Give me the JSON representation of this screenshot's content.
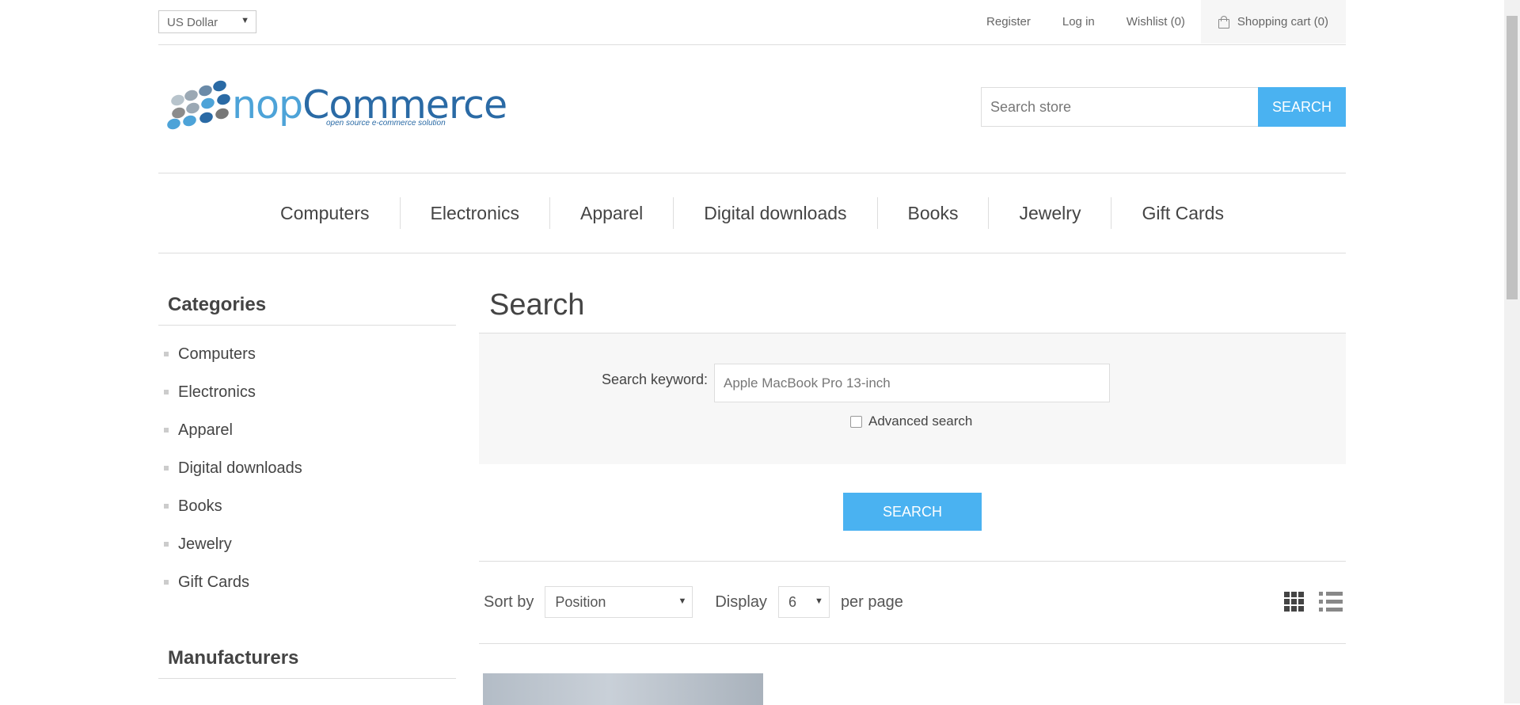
{
  "header": {
    "currency": "US Dollar",
    "links": {
      "register": "Register",
      "login": "Log in",
      "wishlist": "Wishlist (0)",
      "cart": "Shopping cart (0)"
    }
  },
  "logo": {
    "brand_part1": "nop",
    "brand_part2": "Commerce",
    "tagline": "open source e-commerce solution"
  },
  "store_search": {
    "placeholder": "Search store",
    "button": "SEARCH"
  },
  "top_menu": [
    "Computers",
    "Electronics",
    "Apparel",
    "Digital downloads",
    "Books",
    "Jewelry",
    "Gift Cards"
  ],
  "sidebar": {
    "categories_title": "Categories",
    "categories": [
      "Computers",
      "Electronics",
      "Apparel",
      "Digital downloads",
      "Books",
      "Jewelry",
      "Gift Cards"
    ],
    "manufacturers_title": "Manufacturers"
  },
  "search_page": {
    "title": "Search",
    "keyword_label": "Search keyword:",
    "keyword_value": "Apple MacBook Pro 13-inch",
    "advanced_label": "Advanced search",
    "advanced_checked": false,
    "submit": "SEARCH"
  },
  "selectors": {
    "sort_label": "Sort by",
    "sort_value": "Position",
    "display_label": "Display",
    "display_value": "6",
    "per_page_label": "per page",
    "view_modes": [
      "grid-icon",
      "list-icon"
    ],
    "active_view": "grid"
  },
  "colors": {
    "accent": "#4ab2f1",
    "text": "#444444",
    "panel": "#f7f7f7"
  }
}
